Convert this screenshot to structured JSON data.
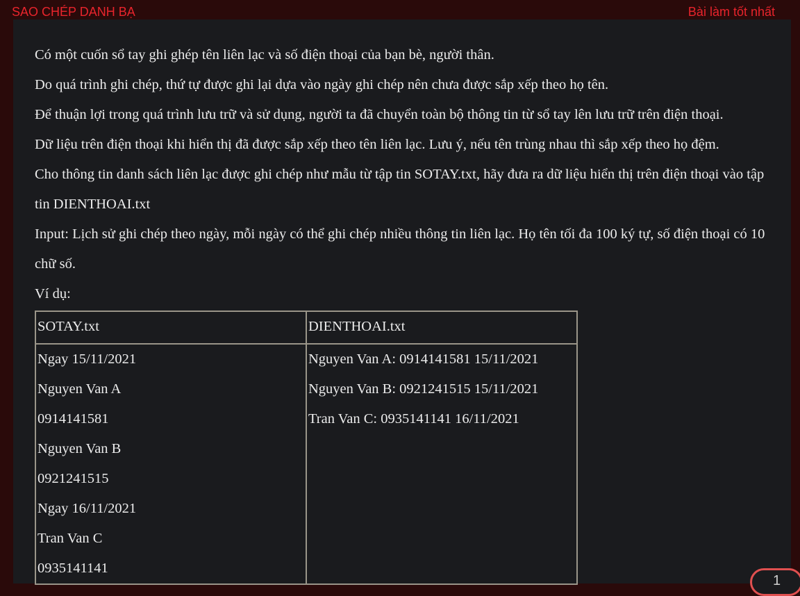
{
  "header": {
    "title": "SAO CHÉP DANH BẠ",
    "best_link": "Bài làm tốt nhất"
  },
  "problem": {
    "paragraphs": [
      "Có một cuốn sổ tay ghi ghép tên liên lạc và số điện thoại của bạn bè, người thân.",
      "Do quá trình ghi chép, thứ tự được ghi lại dựa vào ngày ghi chép nên chưa được sắp xếp theo họ tên.",
      "Để thuận lợi trong quá trình lưu trữ và sử dụng, người ta đã chuyển toàn bộ thông tin từ sổ tay lên lưu trữ trên điện thoại.",
      "Dữ liệu trên điện thoại khi hiển thị đã được sắp xếp theo tên liên lạc. Lưu ý, nếu tên trùng nhau thì sắp xếp theo họ đệm.",
      "Cho thông tin danh sách liên lạc được ghi chép như mẫu từ tập tin SOTAY.txt, hãy đưa ra dữ liệu hiển thị trên điện thoại vào tập tin DIENTHOAI.txt",
      "Input: Lịch sử ghi chép theo ngày, mỗi ngày có thể ghi chép nhiều thông tin liên lạc. Họ tên tối đa 100 ký tự, số điện thoại có 10 chữ số."
    ],
    "example_label": "Ví dụ:"
  },
  "example_table": {
    "headers": [
      "SOTAY.txt",
      "DIENTHOAI.txt"
    ],
    "input_lines": [
      "Ngay 15/11/2021",
      "Nguyen Van A",
      "0914141581",
      "Nguyen Van B",
      "0921241515",
      "Ngay 16/11/2021",
      "Tran Van C",
      "0935141141"
    ],
    "output_lines": [
      "Nguyen Van A: 0914141581 15/11/2021",
      "Nguyen Van B: 0921241515 15/11/2021",
      "Tran Van C: 0935141141 16/11/2021"
    ]
  },
  "badge": {
    "label": "1"
  },
  "colors": {
    "accent": "#e8242c",
    "background": "#1a1b1e",
    "frame": "#2a0a0a"
  }
}
